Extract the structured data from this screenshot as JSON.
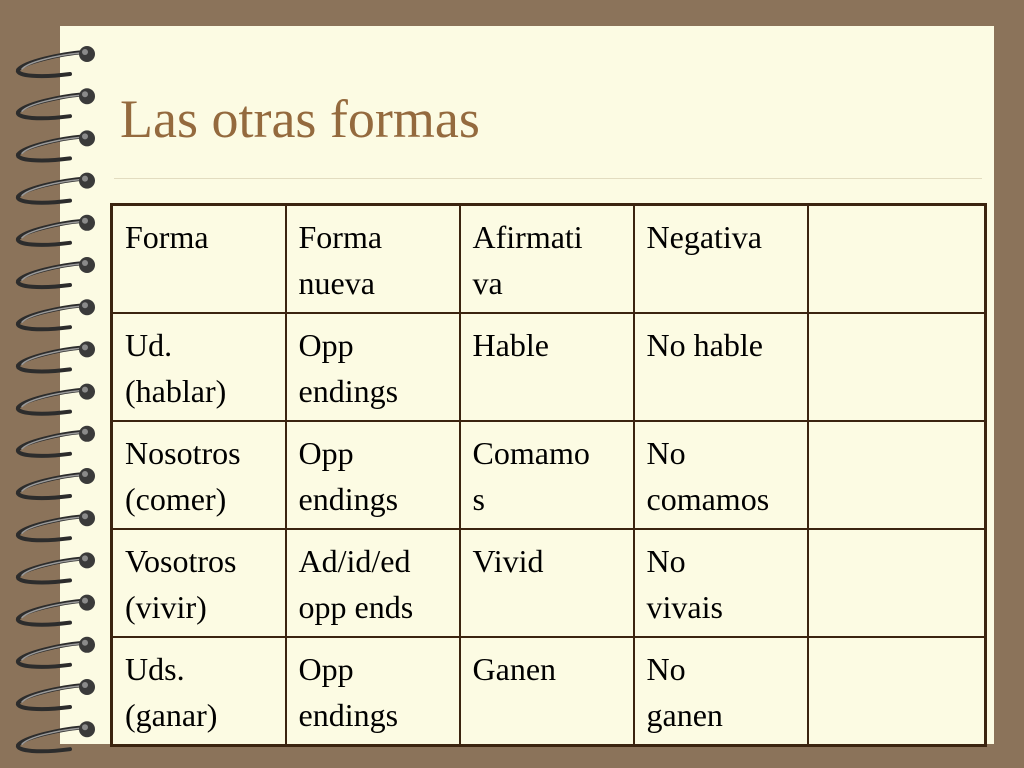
{
  "title": "Las otras formas",
  "table": {
    "rows": [
      [
        [
          "Forma"
        ],
        [
          "Forma",
          "nueva"
        ],
        [
          "Afirmati",
          "va"
        ],
        [
          "Negativa"
        ],
        [
          ""
        ]
      ],
      [
        [
          "Ud.",
          "(hablar)"
        ],
        [
          "Opp",
          "endings"
        ],
        [
          "Hable"
        ],
        [
          "No hable"
        ],
        [
          ""
        ]
      ],
      [
        [
          "Nosotros",
          "(comer)"
        ],
        [
          "Opp",
          "endings"
        ],
        [
          "Comamo",
          "s"
        ],
        [
          "No",
          "comamos"
        ],
        [
          ""
        ]
      ],
      [
        [
          "Vosotros",
          "(vivir)"
        ],
        [
          "Ad/id/ed",
          "opp ends"
        ],
        [
          "Vivid"
        ],
        [
          "No",
          "vivais"
        ],
        [
          ""
        ]
      ],
      [
        [
          "Uds.",
          "(ganar)"
        ],
        [
          "Opp",
          "endings"
        ],
        [
          "Ganen"
        ],
        [
          "No",
          "ganen"
        ],
        [
          ""
        ]
      ]
    ]
  },
  "colors": {
    "background": "#8b735a",
    "page": "#fcfbe3",
    "title": "#946a3e",
    "border": "#3b2410"
  },
  "icons": {
    "binding": "spiral-ring-icon"
  }
}
